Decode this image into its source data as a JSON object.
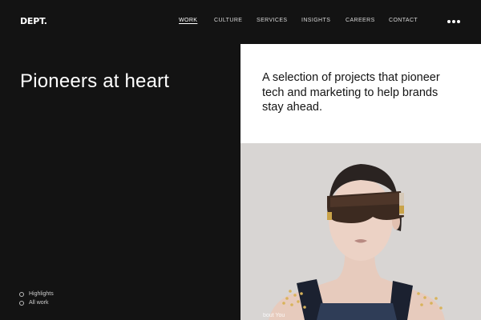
{
  "header": {
    "logo": "DEPT.",
    "nav": [
      {
        "label": "WORK",
        "active": true
      },
      {
        "label": "CULTURE",
        "active": false
      },
      {
        "label": "SERVICES",
        "active": false
      },
      {
        "label": "INSIGHTS",
        "active": false
      },
      {
        "label": "CAREERS",
        "active": false
      },
      {
        "label": "CONTACT",
        "active": false
      }
    ],
    "menu_icon": "more-dots-icon"
  },
  "hero": {
    "title": "Pioneers at heart"
  },
  "intro": {
    "text": "A selection of projects that pioneer tech and marketing to help brands stay ahead."
  },
  "feature": {
    "caption": "bout You"
  },
  "filters": [
    {
      "label": "Highlights"
    },
    {
      "label": "All work"
    }
  ],
  "colors": {
    "background": "#131313",
    "panel": "#ffffff",
    "text_dark": "#141414",
    "text_light": "#ffffff"
  }
}
